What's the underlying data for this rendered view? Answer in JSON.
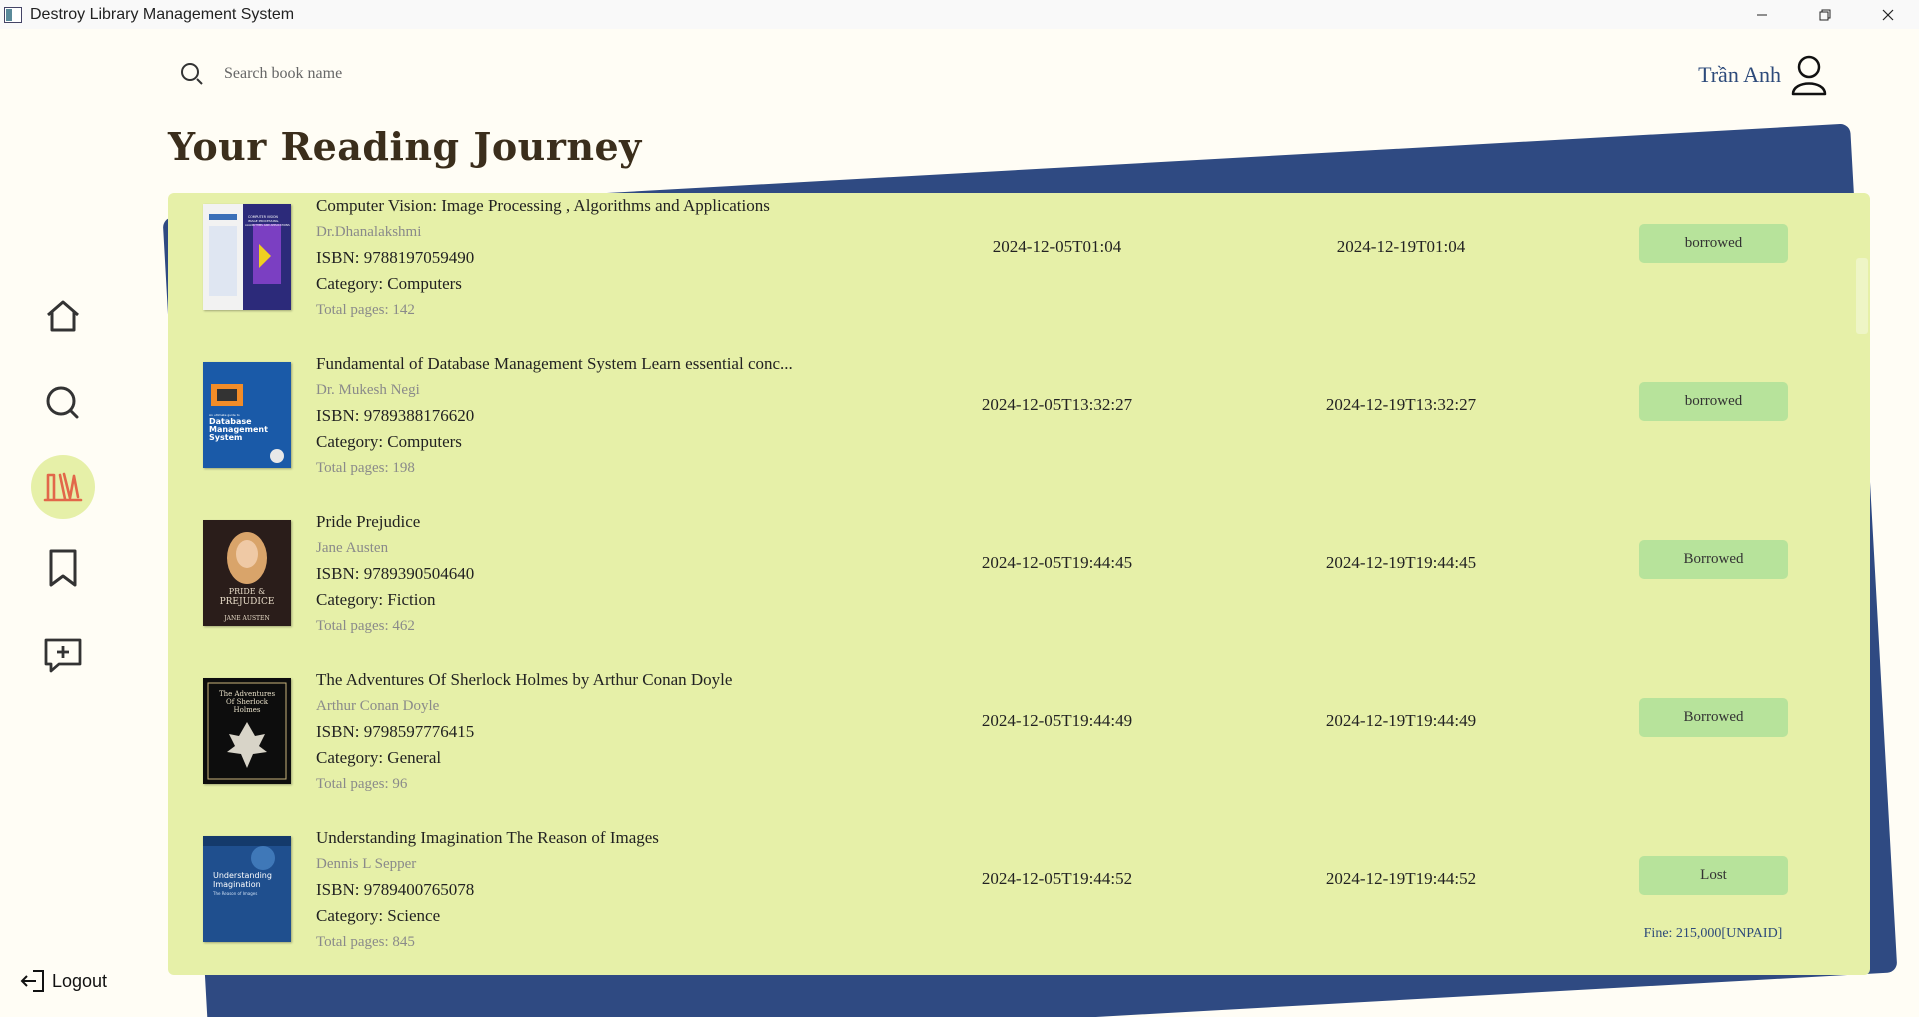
{
  "window": {
    "title": "Destroy Library Management System"
  },
  "search": {
    "placeholder": "Search book name"
  },
  "user": {
    "name": "Trần Anh"
  },
  "page": {
    "title": "Your Reading Journey"
  },
  "sidebar": {
    "items": [
      {
        "name": "home",
        "icon": "home-icon",
        "active": false
      },
      {
        "name": "search",
        "icon": "search-icon",
        "active": false
      },
      {
        "name": "library",
        "icon": "books-icon",
        "active": true
      },
      {
        "name": "bookmarks",
        "icon": "bookmark-icon",
        "active": false
      },
      {
        "name": "feedback",
        "icon": "message-plus-icon",
        "active": false
      }
    ],
    "logout_label": "Logout"
  },
  "books": [
    {
      "title": "Computer Vision: Image Processing , Algorithms and Applications",
      "author": "Dr.Dhanalakshmi",
      "isbn": "ISBN: 9788197059490",
      "category": "Category: Computers",
      "pages": "Total pages: 142",
      "borrow_date": "2024-12-05T01:04",
      "due_date": "2024-12-19T01:04",
      "status": "borrowed",
      "fine": ""
    },
    {
      "title": " Fundamental of Database Management System Learn essential conc...",
      "author": "Dr. Mukesh Negi",
      "isbn": "ISBN: 9789388176620",
      "category": "Category: Computers",
      "pages": "Total pages: 198",
      "borrow_date": "2024-12-05T13:32:27",
      "due_date": "2024-12-19T13:32:27",
      "status": "borrowed",
      "fine": ""
    },
    {
      "title": "Pride Prejudice",
      "author": "Jane Austen",
      "isbn": "ISBN: 9789390504640",
      "category": "Category: Fiction",
      "pages": "Total pages: 462",
      "borrow_date": "2024-12-05T19:44:45",
      "due_date": "2024-12-19T19:44:45",
      "status": "Borrowed",
      "fine": ""
    },
    {
      "title": "The Adventures Of Sherlock Holmes by Arthur Conan Doyle",
      "author": "Arthur Conan Doyle",
      "isbn": "ISBN: 9798597776415",
      "category": "Category: General",
      "pages": "Total pages: 96",
      "borrow_date": "2024-12-05T19:44:49",
      "due_date": "2024-12-19T19:44:49",
      "status": "Borrowed",
      "fine": ""
    },
    {
      "title": "Understanding Imagination The Reason of Images",
      "author": "Dennis L Sepper",
      "isbn": "ISBN: 9789400765078",
      "category": "Category: Science",
      "pages": "Total pages: 845",
      "borrow_date": "2024-12-05T19:44:52",
      "due_date": "2024-12-19T19:44:52",
      "status": "Lost",
      "fine": "Fine: 215,000[UNPAID]"
    }
  ],
  "covers": [
    {
      "title_lines": [
        "COMPUTER VISION",
        "IMAGE PROCESSING,",
        "ALGORITHMS AND APPLICATIONS"
      ]
    },
    {
      "title_lines": [
        "Database",
        "Management",
        "System"
      ],
      "subtitle": "An ultimate guide to"
    },
    {
      "title_lines": [
        "PRIDE &",
        "PREJUDICE"
      ],
      "subtitle": "JANE AUSTEN"
    },
    {
      "title_lines": [
        "The Adventures",
        "Of Sherlock",
        "Holmes"
      ]
    },
    {
      "title_lines": [
        "Understanding",
        "Imagination"
      ],
      "subtitle": "The Reason of Images"
    }
  ],
  "colors": {
    "background": "#fffdf5",
    "card": "#e6f0a8",
    "accent_blue": "#2f4a82",
    "status_badge": "#b7e39b",
    "active_nav": "#e6f0a8",
    "active_icon": "#e2674a"
  }
}
